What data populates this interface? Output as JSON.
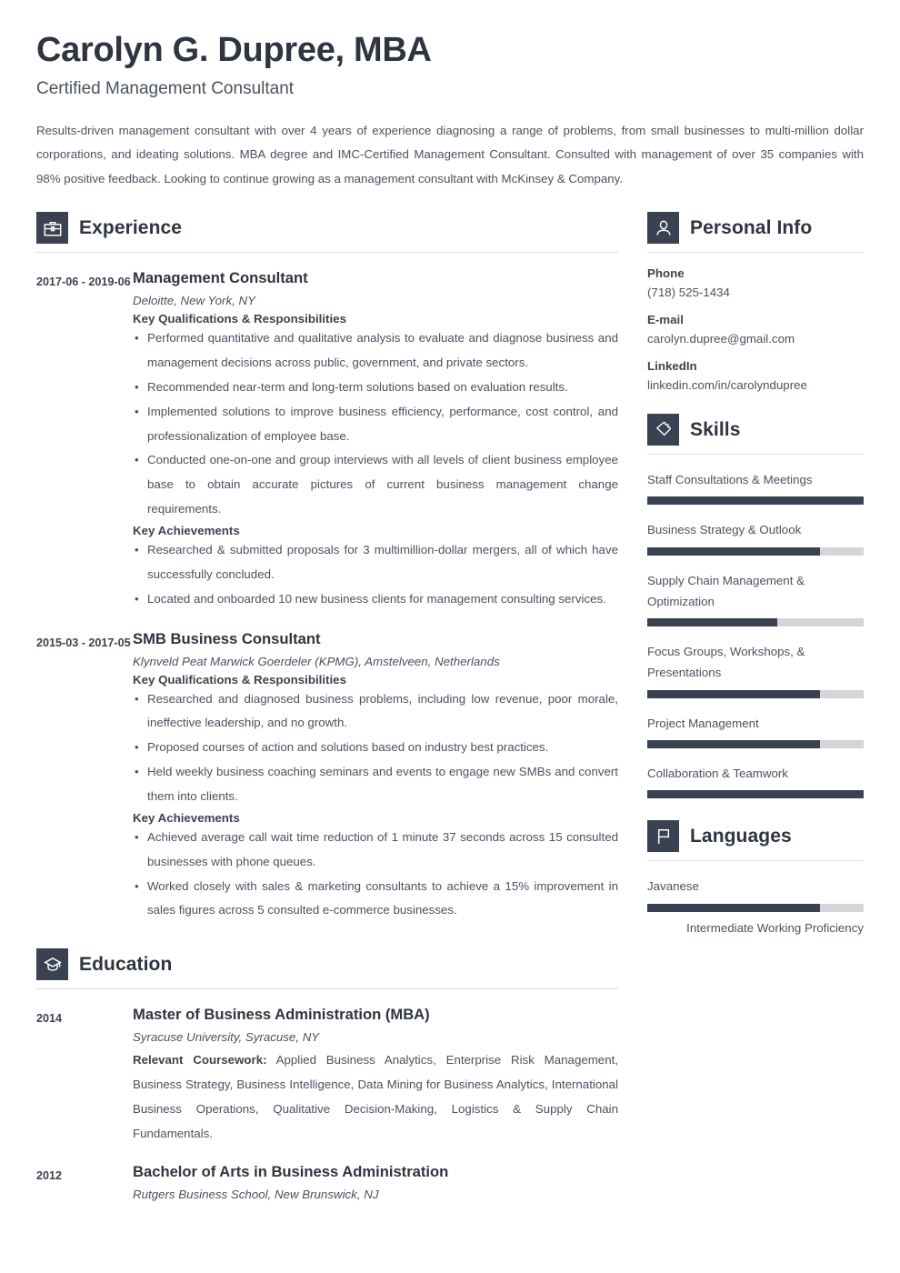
{
  "header": {
    "name": "Carolyn G. Dupree, MBA",
    "job_title": "Certified Management Consultant",
    "summary": "Results-driven management consultant with over 4 years of experience diagnosing a range of problems, from small businesses to multi-million dollar corporations, and ideating solutions. MBA degree and IMC-Certified Management Consultant. Consulted with management of over 35 companies with 98% positive feedback. Looking to continue growing as a management consultant with McKinsey & Company."
  },
  "experience": {
    "section_title": "Experience",
    "icon": "briefcase-icon",
    "entries": [
      {
        "date": "2017-06 - 2019-06",
        "title": "Management Consultant",
        "subtitle": "Deloitte, New York, NY",
        "qual_label": "Key Qualifications & Responsibilities",
        "qualifications": [
          "Performed quantitative and qualitative analysis to evaluate and diagnose business and management decisions across public, government, and private sectors.",
          "Recommended near-term and long-term solutions based on evaluation results.",
          "Implemented solutions to improve business efficiency, performance, cost control, and professionalization of employee base.",
          "Conducted one-on-one and group interviews with all levels of client business employee base to obtain accurate pictures of current business management change requirements."
        ],
        "ach_label": "Key Achievements",
        "achievements": [
          "Researched & submitted proposals for 3 multimillion-dollar mergers, all of which have successfully concluded.",
          "Located and onboarded 10 new business clients for management consulting services."
        ]
      },
      {
        "date": "2015-03 - 2017-05",
        "title": "SMB Business Consultant",
        "subtitle": "Klynveld Peat Marwick Goerdeler (KPMG), Amstelveen, Netherlands",
        "qual_label": "Key Qualifications & Responsibilities",
        "qualifications": [
          "Researched and diagnosed business problems, including low revenue, poor morale, ineffective leadership, and no growth.",
          "Proposed courses of action and solutions based on industry best practices.",
          "Held weekly business coaching seminars and events to engage new SMBs and convert them into clients."
        ],
        "ach_label": "Key Achievements",
        "achievements": [
          "Achieved average call wait time reduction of 1 minute 37 seconds across 15 consulted businesses with phone queues.",
          "Worked closely with sales & marketing consultants to achieve a 15% improvement in sales figures across 5 consulted e-commerce businesses."
        ]
      }
    ]
  },
  "education": {
    "section_title": "Education",
    "icon": "graduation-cap-icon",
    "entries": [
      {
        "date": "2014",
        "title": "Master of Business Administration (MBA)",
        "subtitle": "Syracuse University, Syracuse, NY",
        "coursework_label": "Relevant Coursework:",
        "coursework": "Applied Business Analytics, Enterprise Risk Management, Business Strategy, Business Intelligence, Data Mining for Business Analytics, International Business Operations, Qualitative Decision-Making, Logistics & Supply Chain Fundamentals."
      },
      {
        "date": "2012",
        "title": "Bachelor of Arts in Business Administration",
        "subtitle": "Rutgers Business School, New Brunswick, NJ",
        "coursework_label": "",
        "coursework": ""
      }
    ]
  },
  "personal_info": {
    "section_title": "Personal Info",
    "icon": "person-icon",
    "fields": [
      {
        "label": "Phone",
        "value": "(718) 525-1434"
      },
      {
        "label": "E-mail",
        "value": "carolyn.dupree@gmail.com"
      },
      {
        "label": "LinkedIn",
        "value": "linkedin.com/in/carolyndupree"
      }
    ]
  },
  "skills": {
    "section_title": "Skills",
    "icon": "puzzle-piece-icon",
    "items": [
      {
        "name": "Staff Consultations & Meetings",
        "level": 100
      },
      {
        "name": "Business Strategy & Outlook",
        "level": 80
      },
      {
        "name": "Supply Chain Management & Optimization",
        "level": 60
      },
      {
        "name": "Focus Groups, Workshops, & Presentations",
        "level": 80
      },
      {
        "name": "Project Management",
        "level": 80
      },
      {
        "name": "Collaboration & Teamwork",
        "level": 100
      }
    ]
  },
  "languages": {
    "section_title": "Languages",
    "icon": "flag-icon",
    "items": [
      {
        "name": "Javanese",
        "level": 80,
        "proficiency": "Intermediate Working Proficiency"
      }
    ]
  },
  "colors": {
    "dark": "#3a4150",
    "text": "#4a5160",
    "heading": "#2e3440",
    "bar_track": "#d3d5d7",
    "rule": "#d9dbdf"
  }
}
